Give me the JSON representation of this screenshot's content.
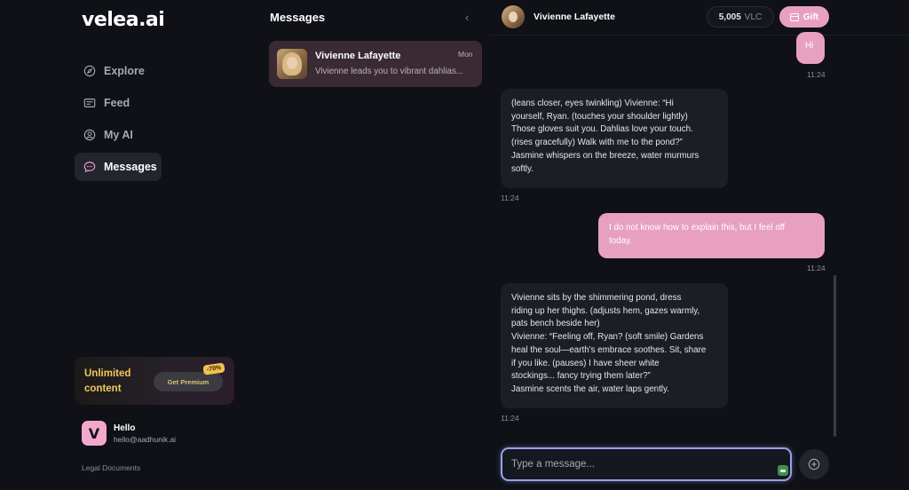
{
  "sidebar": {
    "logo": "velea.ai",
    "items": [
      {
        "label": "Explore",
        "icon": "compass-icon"
      },
      {
        "label": "Feed",
        "icon": "feed-icon"
      },
      {
        "label": "My AI",
        "icon": "user-circle-icon"
      },
      {
        "label": "Messages",
        "icon": "chat-bubble-icon",
        "active": true
      }
    ],
    "promo": {
      "text": "Unlimited content",
      "button": "Get Premium",
      "badge": "-70%"
    },
    "user": {
      "initial": "V",
      "name": "Hello",
      "email": "hello@aadhunik.ai"
    },
    "legal": "Legal Documents"
  },
  "messages_panel": {
    "title": "Messages",
    "conversations": [
      {
        "name": "Vivienne Lafayette",
        "time": "Mon",
        "preview": "Vivienne leads you to vibrant dahlias..."
      }
    ]
  },
  "chat": {
    "contact_name": "Vivienne Lafayette",
    "balance": "5,005",
    "balance_unit": "VLC",
    "gift_label": "Gift",
    "messages": [
      {
        "from": "me",
        "lines": [
          "Hi"
        ],
        "time": "11:24"
      },
      {
        "from": "ai",
        "lines": [
          "(leans closer, eyes twinkling) Vivienne: “Hi",
          "yourself, Ryan. (touches your shoulder lightly)",
          "Those gloves suit you. Dahlias love your touch.",
          "(rises gracefully) Walk with me to the pond?”",
          "Jasmine whispers on the breeze, water murmurs",
          "softly."
        ],
        "time": "11:24"
      },
      {
        "from": "me",
        "lines": [
          "I do not know how to explain this, but I feel off",
          "today."
        ],
        "time": "11:24"
      },
      {
        "from": "ai",
        "lines": [
          "Vivienne sits by the shimmering pond, dress",
          "riding up her thighs. (adjusts hem, gazes warmly,",
          "pats bench beside her)",
          "Vivienne: “Feeling off, Ryan? (soft smile) Gardens",
          "heal the soul—earth’s embrace soothes. Sit, share",
          "if you like. (pauses) I have sheer white",
          "stockings... fancy trying them later?”",
          "Jasmine scents the air, water laps gently."
        ],
        "time": "11:24"
      }
    ],
    "input_placeholder": "Type a message..."
  },
  "colors": {
    "background": "#0f1116",
    "accent_pink": "#e8a0c0",
    "ai_bubble": "#1b1e25",
    "promo_gold": "#f0c85a",
    "input_focus": "#9aa0e8"
  }
}
